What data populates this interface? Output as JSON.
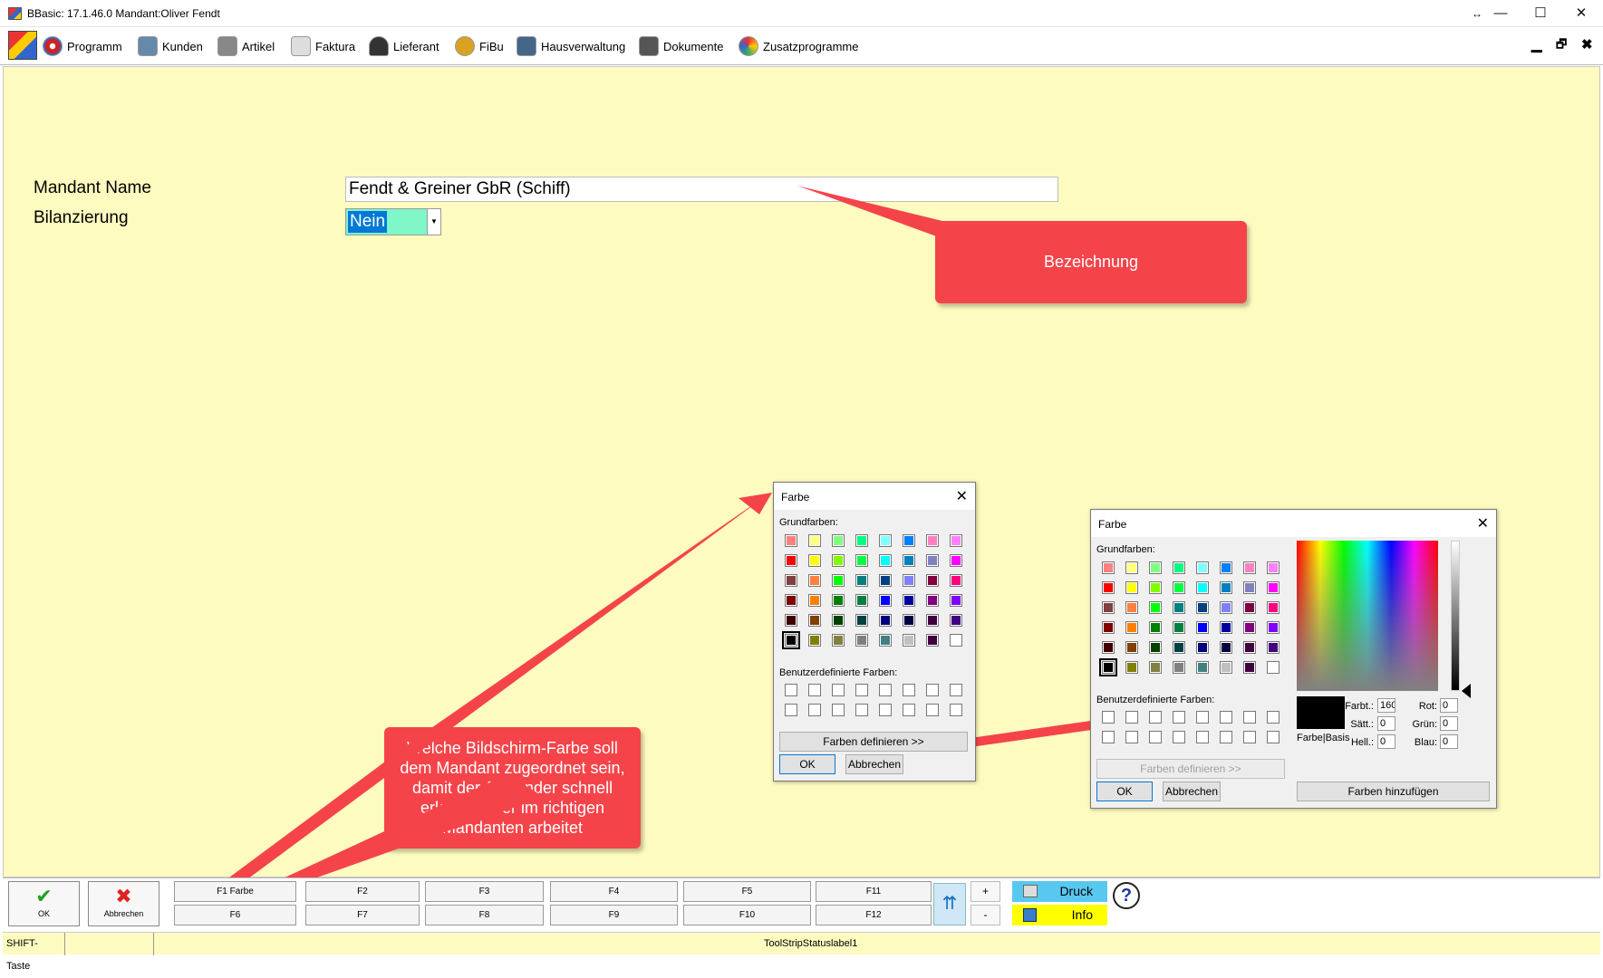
{
  "window": {
    "title": "BBasic: 17.1.46.0 Mandant:Oliver Fendt",
    "controls": [
      "↔",
      "—",
      "☐",
      "✕"
    ]
  },
  "menubar": {
    "items": [
      {
        "label": "Programm",
        "icon": "programm-icon",
        "color": "#cc2222"
      },
      {
        "label": "Kunden",
        "icon": "kunden-icon",
        "color": "#6688aa"
      },
      {
        "label": "Artikel",
        "icon": "artikel-icon",
        "color": "#888888"
      },
      {
        "label": "Faktura",
        "icon": "faktura-icon",
        "color": "#dddddd"
      },
      {
        "label": "Lieferant",
        "icon": "lieferant-icon",
        "color": "#333333"
      },
      {
        "label": "FiBu",
        "icon": "fibu-icon",
        "color": "#d9a321"
      },
      {
        "label": "Hausverwaltung",
        "icon": "hausverwaltung-icon",
        "color": "#446688"
      },
      {
        "label": "Dokumente",
        "icon": "dokumente-icon",
        "color": "#555555"
      },
      {
        "label": "Zusatzprogramme",
        "icon": "zusatzprogramme-icon",
        "color": "#44aa66"
      }
    ],
    "mdi_controls": [
      "▁",
      "🗗",
      "✖"
    ]
  },
  "form": {
    "mandant_name_label": "Mandant Name",
    "mandant_name_value": "Fendt & Greiner GbR (Schiff)",
    "bilanzierung_label": "Bilanzierung",
    "bilanzierung_value": "Nein"
  },
  "callouts": {
    "bezeichnung": "Bezeichnung",
    "farbe_hint": "Welche Bildschirm-Farbe soll dem Mandant zugeordnet sein, damit der Anwender schnell erkennt ob er im richtigen Mandanten arbeitet"
  },
  "basic_colors": [
    "#ff8080",
    "#ffff80",
    "#80ff80",
    "#00ff80",
    "#80ffff",
    "#0080ff",
    "#ff80c0",
    "#ff80ff",
    "#ff0000",
    "#ffff00",
    "#80ff00",
    "#00ff40",
    "#00ffff",
    "#0080c0",
    "#8080c0",
    "#ff00ff",
    "#804040",
    "#ff8040",
    "#00ff00",
    "#008080",
    "#004080",
    "#8080ff",
    "#800040",
    "#ff0080",
    "#800000",
    "#ff8000",
    "#008000",
    "#008040",
    "#0000ff",
    "#0000a0",
    "#800080",
    "#8000ff",
    "#400000",
    "#804000",
    "#004000",
    "#004040",
    "#000080",
    "#000040",
    "#400040",
    "#400080",
    "#000000",
    "#808000",
    "#808040",
    "#808080",
    "#408080",
    "#c0c0c0",
    "#400040",
    "#ffffff"
  ],
  "dialog_small": {
    "title": "Farbe",
    "basic_label": "Grundfarben:",
    "custom_label": "Benutzerdefinierte Farben:",
    "define_button": "Farben definieren >>",
    "ok": "OK",
    "cancel": "Abbrechen"
  },
  "dialog_large": {
    "title": "Farbe",
    "basic_label": "Grundfarben:",
    "custom_label": "Benutzerdefinierte Farben:",
    "define_button": "Farben definieren >>",
    "ok": "OK",
    "cancel": "Abbrechen",
    "preview_label": "Farbe|Basis",
    "fields": [
      {
        "label": "Farbt.:",
        "value": "160"
      },
      {
        "label": "Sätt.:",
        "value": "0"
      },
      {
        "label": "Hell.:",
        "value": "0"
      },
      {
        "label": "Rot:",
        "value": "0"
      },
      {
        "label": "Grün:",
        "value": "0"
      },
      {
        "label": "Blau:",
        "value": "0"
      }
    ],
    "add_button": "Farben hinzufügen"
  },
  "toolbar": {
    "ok": "OK",
    "cancel": "Abbrechen",
    "fkeys_top": [
      "F1 Farbe",
      "F2",
      "F3",
      "F4",
      "F5",
      "F11"
    ],
    "fkeys_bottom": [
      "F6",
      "F7",
      "F8",
      "F9",
      "F10",
      "F12"
    ],
    "plus": "+",
    "minus": "-",
    "druck": "Druck",
    "info": "Info",
    "help": "?"
  },
  "statusbar": {
    "shift": "SHIFT-Taste",
    "label": "ToolStripStatuslabel1"
  }
}
